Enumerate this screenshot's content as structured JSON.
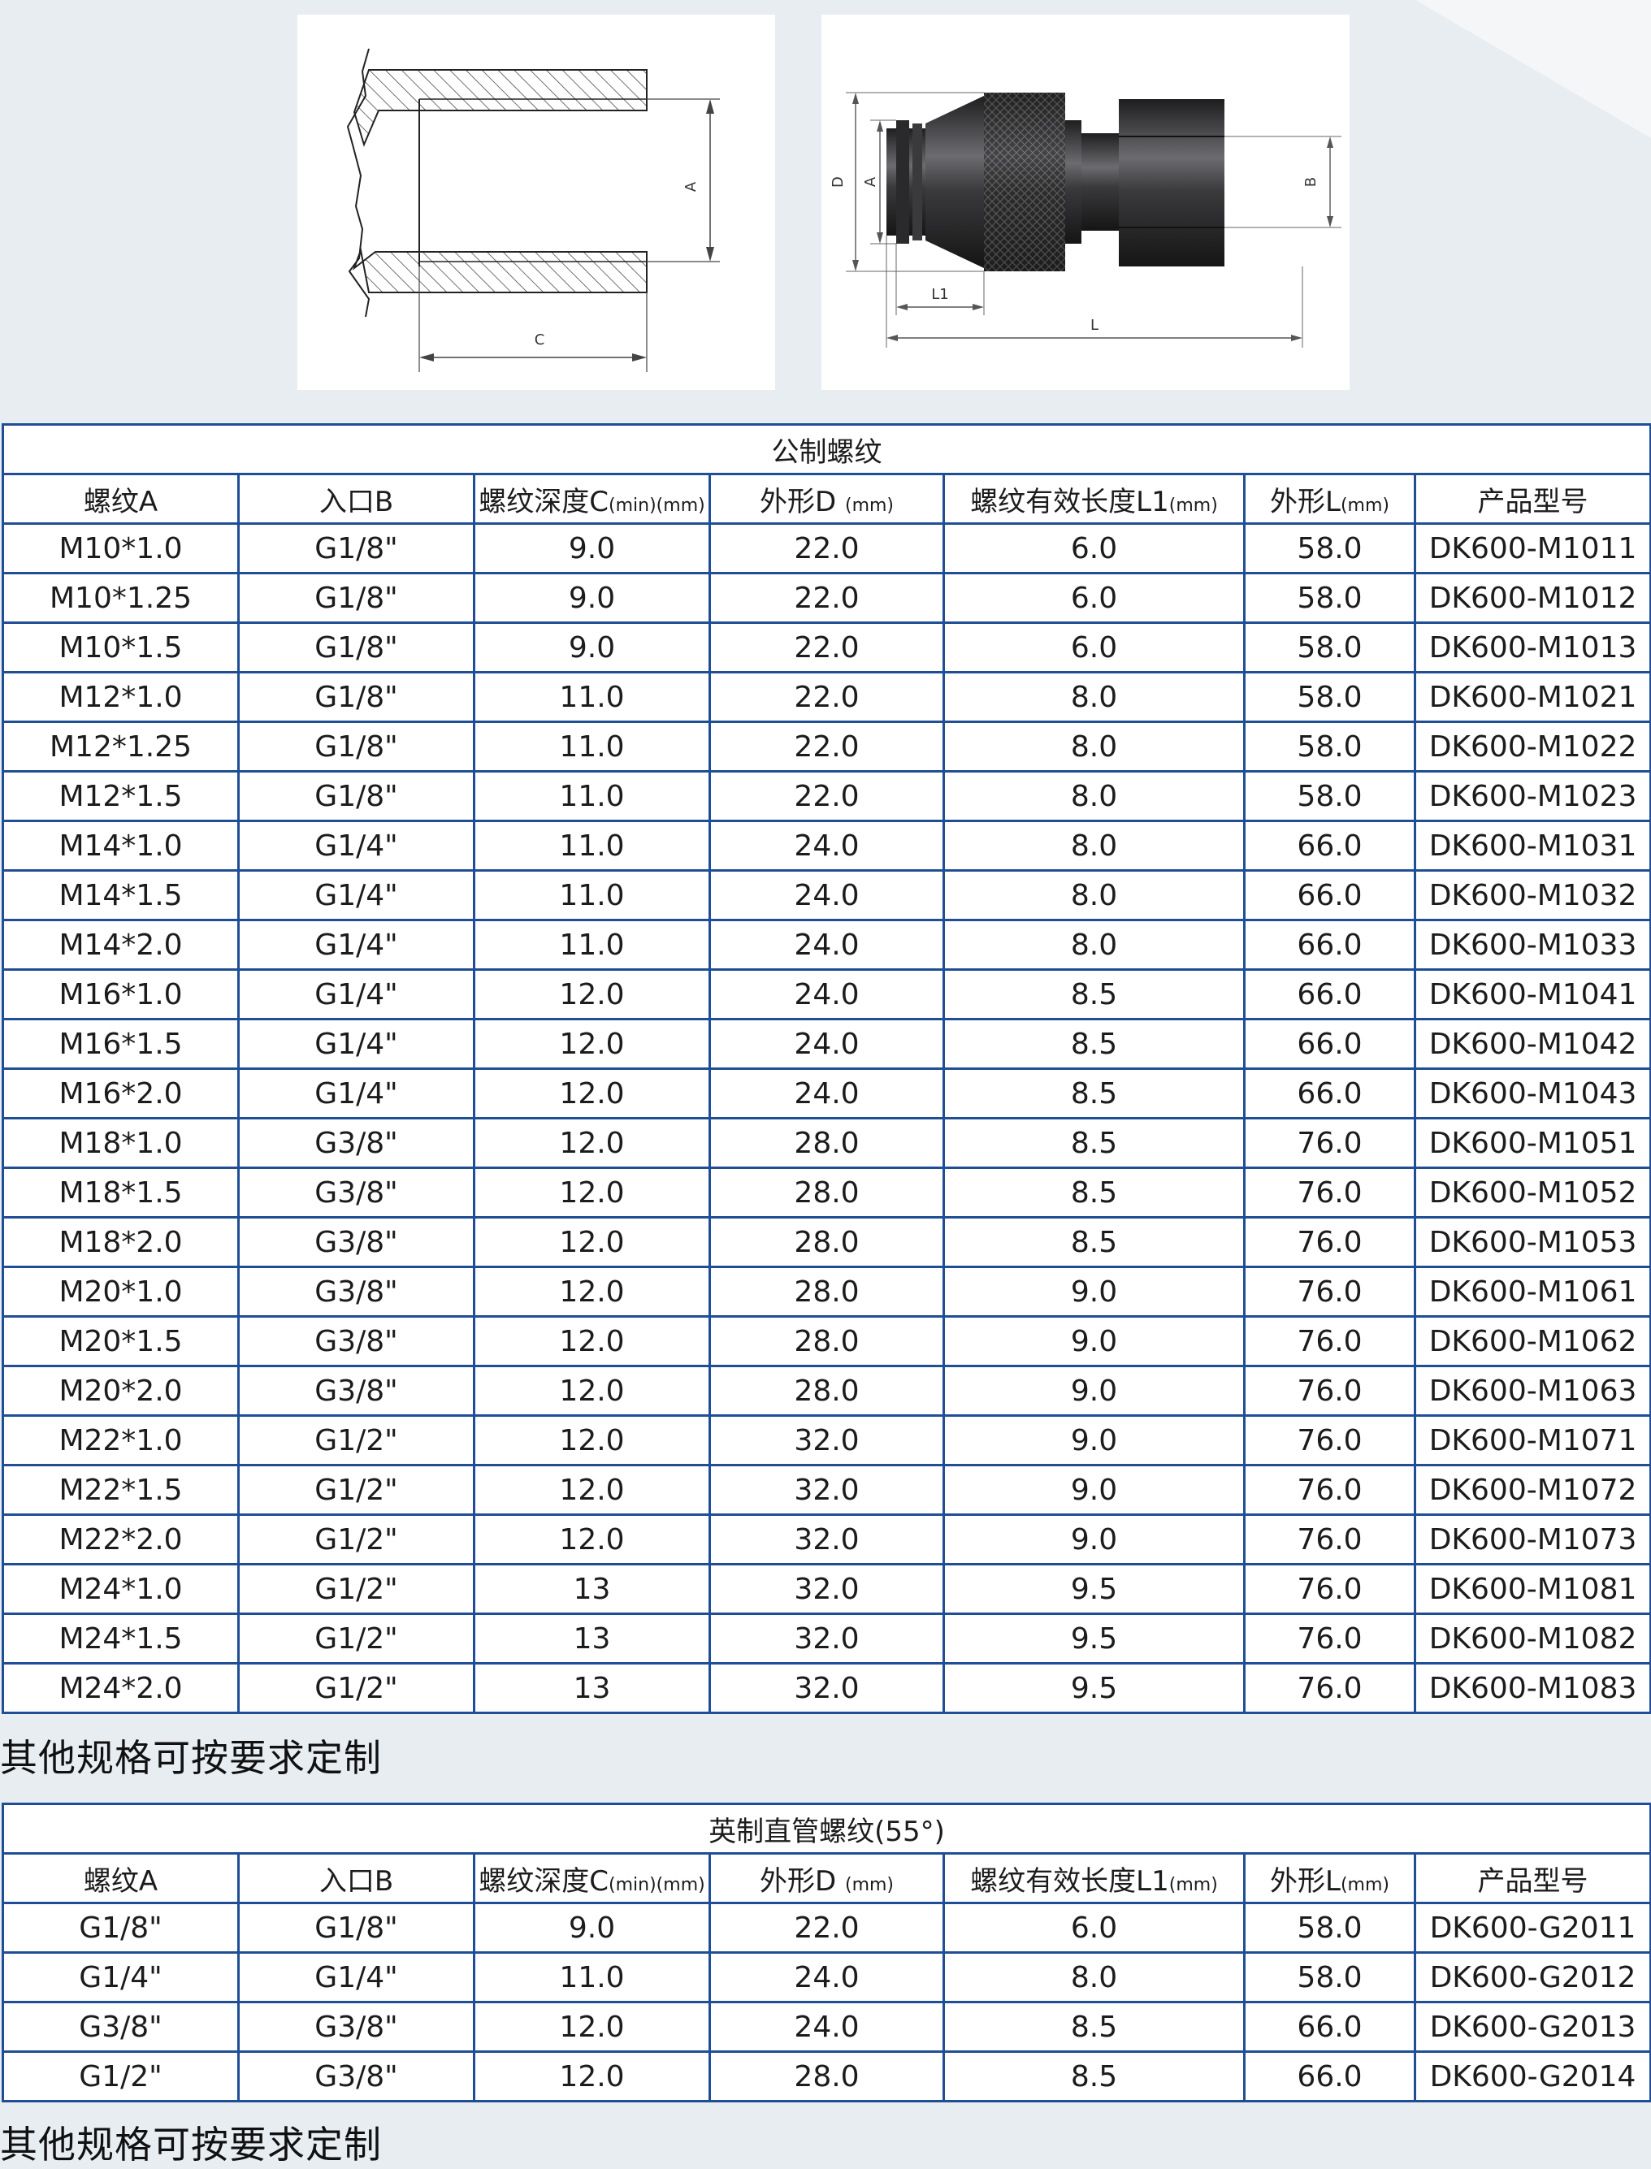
{
  "diagram_section": {
    "section_labels": [
      "A",
      "C"
    ],
    "fitting_labels": [
      "D",
      "A",
      "B",
      "L1",
      "L"
    ]
  },
  "metric_table": {
    "title": "公制螺纹",
    "headers": [
      {
        "main": "螺纹A",
        "unit": ""
      },
      {
        "main": "入口B",
        "unit": ""
      },
      {
        "main": "螺纹深度C",
        "unit": "(min)(mm)"
      },
      {
        "main": "外形D ",
        "unit": "(mm)"
      },
      {
        "main": "螺纹有效长度L1",
        "unit": "(mm)"
      },
      {
        "main": "外形L",
        "unit": "(mm)"
      },
      {
        "main": "产品型号",
        "unit": ""
      }
    ],
    "rows": [
      [
        "M10*1.0",
        "G1/8\"",
        "9.0",
        "22.0",
        "6.0",
        "58.0",
        "DK600-M1011"
      ],
      [
        "M10*1.25",
        "G1/8\"",
        "9.0",
        "22.0",
        "6.0",
        "58.0",
        "DK600-M1012"
      ],
      [
        "M10*1.5",
        "G1/8\"",
        "9.0",
        "22.0",
        "6.0",
        "58.0",
        "DK600-M1013"
      ],
      [
        "M12*1.0",
        "G1/8\"",
        "11.0",
        "22.0",
        "8.0",
        "58.0",
        "DK600-M1021"
      ],
      [
        "M12*1.25",
        "G1/8\"",
        "11.0",
        "22.0",
        "8.0",
        "58.0",
        "DK600-M1022"
      ],
      [
        "M12*1.5",
        "G1/8\"",
        "11.0",
        "22.0",
        "8.0",
        "58.0",
        "DK600-M1023"
      ],
      [
        "M14*1.0",
        "G1/4\"",
        "11.0",
        "24.0",
        "8.0",
        "66.0",
        "DK600-M1031"
      ],
      [
        "M14*1.5",
        "G1/4\"",
        "11.0",
        "24.0",
        "8.0",
        "66.0",
        "DK600-M1032"
      ],
      [
        "M14*2.0",
        "G1/4\"",
        "11.0",
        "24.0",
        "8.0",
        "66.0",
        "DK600-M1033"
      ],
      [
        "M16*1.0",
        "G1/4\"",
        "12.0",
        "24.0",
        "8.5",
        "66.0",
        "DK600-M1041"
      ],
      [
        "M16*1.5",
        "G1/4\"",
        "12.0",
        "24.0",
        "8.5",
        "66.0",
        "DK600-M1042"
      ],
      [
        "M16*2.0",
        "G1/4\"",
        "12.0",
        "24.0",
        "8.5",
        "66.0",
        "DK600-M1043"
      ],
      [
        "M18*1.0",
        "G3/8\"",
        "12.0",
        "28.0",
        "8.5",
        "76.0",
        "DK600-M1051"
      ],
      [
        "M18*1.5",
        "G3/8\"",
        "12.0",
        "28.0",
        "8.5",
        "76.0",
        "DK600-M1052"
      ],
      [
        "M18*2.0",
        "G3/8\"",
        "12.0",
        "28.0",
        "8.5",
        "76.0",
        "DK600-M1053"
      ],
      [
        "M20*1.0",
        "G3/8\"",
        "12.0",
        "28.0",
        "9.0",
        "76.0",
        "DK600-M1061"
      ],
      [
        "M20*1.5",
        "G3/8\"",
        "12.0",
        "28.0",
        "9.0",
        "76.0",
        "DK600-M1062"
      ],
      [
        "M20*2.0",
        "G3/8\"",
        "12.0",
        "28.0",
        "9.0",
        "76.0",
        "DK600-M1063"
      ],
      [
        "M22*1.0",
        "G1/2\"",
        "12.0",
        "32.0",
        "9.0",
        "76.0",
        "DK600-M1071"
      ],
      [
        "M22*1.5",
        "G1/2\"",
        "12.0",
        "32.0",
        "9.0",
        "76.0",
        "DK600-M1072"
      ],
      [
        "M22*2.0",
        "G1/2\"",
        "12.0",
        "32.0",
        "9.0",
        "76.0",
        "DK600-M1073"
      ],
      [
        "M24*1.0",
        "G1/2\"",
        "13",
        "32.0",
        "9.5",
        "76.0",
        "DK600-M1081"
      ],
      [
        "M24*1.5",
        "G1/2\"",
        "13",
        "32.0",
        "9.5",
        "76.0",
        "DK600-M1082"
      ],
      [
        "M24*2.0",
        "G1/2\"",
        "13",
        "32.0",
        "9.5",
        "76.0",
        "DK600-M1083"
      ]
    ],
    "note": "其他规格可按要求定制"
  },
  "imperial_table": {
    "title": "英制直管螺纹(55°)",
    "headers": [
      {
        "main": "螺纹A",
        "unit": ""
      },
      {
        "main": "入口B",
        "unit": ""
      },
      {
        "main": "螺纹深度C",
        "unit": "(min)(mm)"
      },
      {
        "main": "外形D ",
        "unit": "(mm)"
      },
      {
        "main": "螺纹有效长度L1",
        "unit": "(mm)"
      },
      {
        "main": "外形L",
        "unit": "(mm)"
      },
      {
        "main": "产品型号",
        "unit": ""
      }
    ],
    "rows": [
      [
        "G1/8\"",
        "G1/8\"",
        "9.0",
        "22.0",
        "6.0",
        "58.0",
        "DK600-G2011"
      ],
      [
        "G1/4\"",
        "G1/4\"",
        "11.0",
        "24.0",
        "8.0",
        "58.0",
        "DK600-G2012"
      ],
      [
        "G3/8\"",
        "G3/8\"",
        "12.0",
        "24.0",
        "8.5",
        "66.0",
        "DK600-G2013"
      ],
      [
        "G1/2\"",
        "G3/8\"",
        "12.0",
        "28.0",
        "8.5",
        "66.0",
        "DK600-G2014"
      ]
    ],
    "note": "其他规格可按要求定制"
  },
  "colors": {
    "border": "#1f4e96",
    "background": "#e8edf2",
    "fitting_body": "#2e2e30"
  }
}
